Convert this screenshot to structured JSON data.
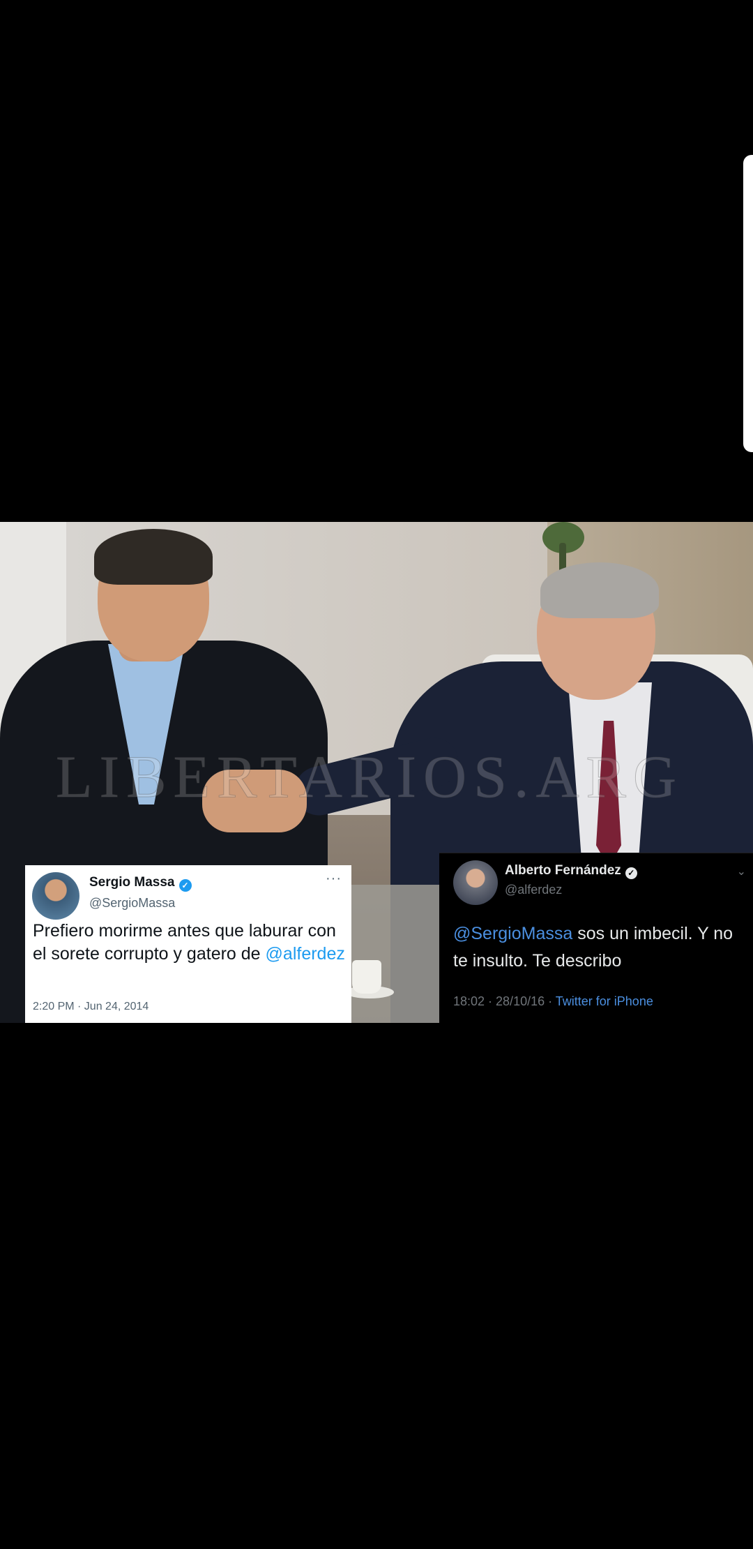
{
  "photo": {
    "watermark": "LIBERTARIOS.ARG"
  },
  "tweet_left": {
    "name": "Sergio Massa",
    "handle": "@SergioMassa",
    "more_icon": "···",
    "text_main": "Prefiero morirme antes que laburar con el sorete corrupto y gatero de ",
    "mention": "@alferdez",
    "timestamp": "2:20 PM · Jun 24, 2014",
    "verified_icon": "verified-badge-icon"
  },
  "tweet_right": {
    "name": "Alberto Fernández",
    "handle": "@alferdez",
    "mention": "@SergioMassa",
    "text_main": " sos un imbecil. Y no te insulto. Te describo",
    "timestamp": "18:02 · 28/10/16 · ",
    "source": "Twitter for iPhone",
    "verified_icon": "verified-badge-icon"
  },
  "colors": {
    "background": "#000000",
    "twitter_blue": "#1d9bf0",
    "mention_dark": "#4b8fe0"
  }
}
